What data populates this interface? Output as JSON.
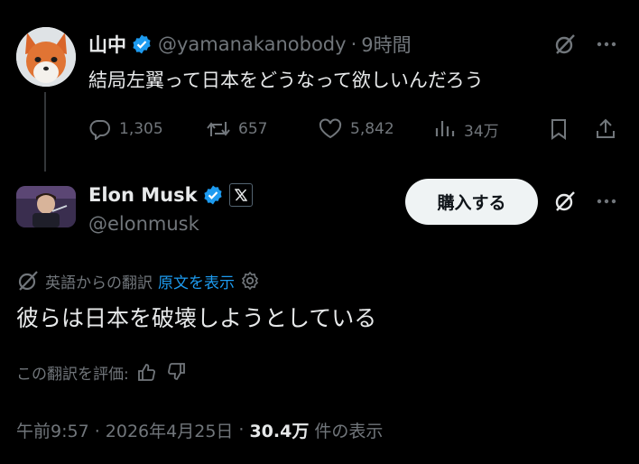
{
  "parent": {
    "name": "山中",
    "handle": "@yamanakanobody",
    "separator": "·",
    "time": "9時間",
    "text": "結局左翼って日本をどうなって欲しいんだろう",
    "stats": {
      "replies": "1,305",
      "reposts": "657",
      "likes": "5,842",
      "views": "34万"
    }
  },
  "reply": {
    "name": "Elon Musk",
    "handle": "@elonmusk",
    "buy_label": "購入する",
    "translated_from": "英語からの翻訳",
    "show_original": "原文を表示",
    "text": "彼らは日本を破壊しようとしている",
    "rate_label": "この翻訳を評価:",
    "timestamp": "午前9:57 · 2026年4月25日",
    "meta_sep": "·",
    "views_count": "30.4万",
    "views_label": "件の表示"
  },
  "colors": {
    "background": "#000000",
    "text": "#e7e9ea",
    "muted": "#71767b",
    "accent": "#1d9bf0"
  },
  "icons": [
    "verified-badge-icon",
    "grok-icon",
    "more-icon",
    "reply-icon",
    "repost-icon",
    "like-icon",
    "views-icon",
    "bookmark-icon",
    "share-icon",
    "x-logo-icon",
    "translate-icon",
    "settings-icon",
    "thumbs-up-icon",
    "thumbs-down-icon"
  ]
}
